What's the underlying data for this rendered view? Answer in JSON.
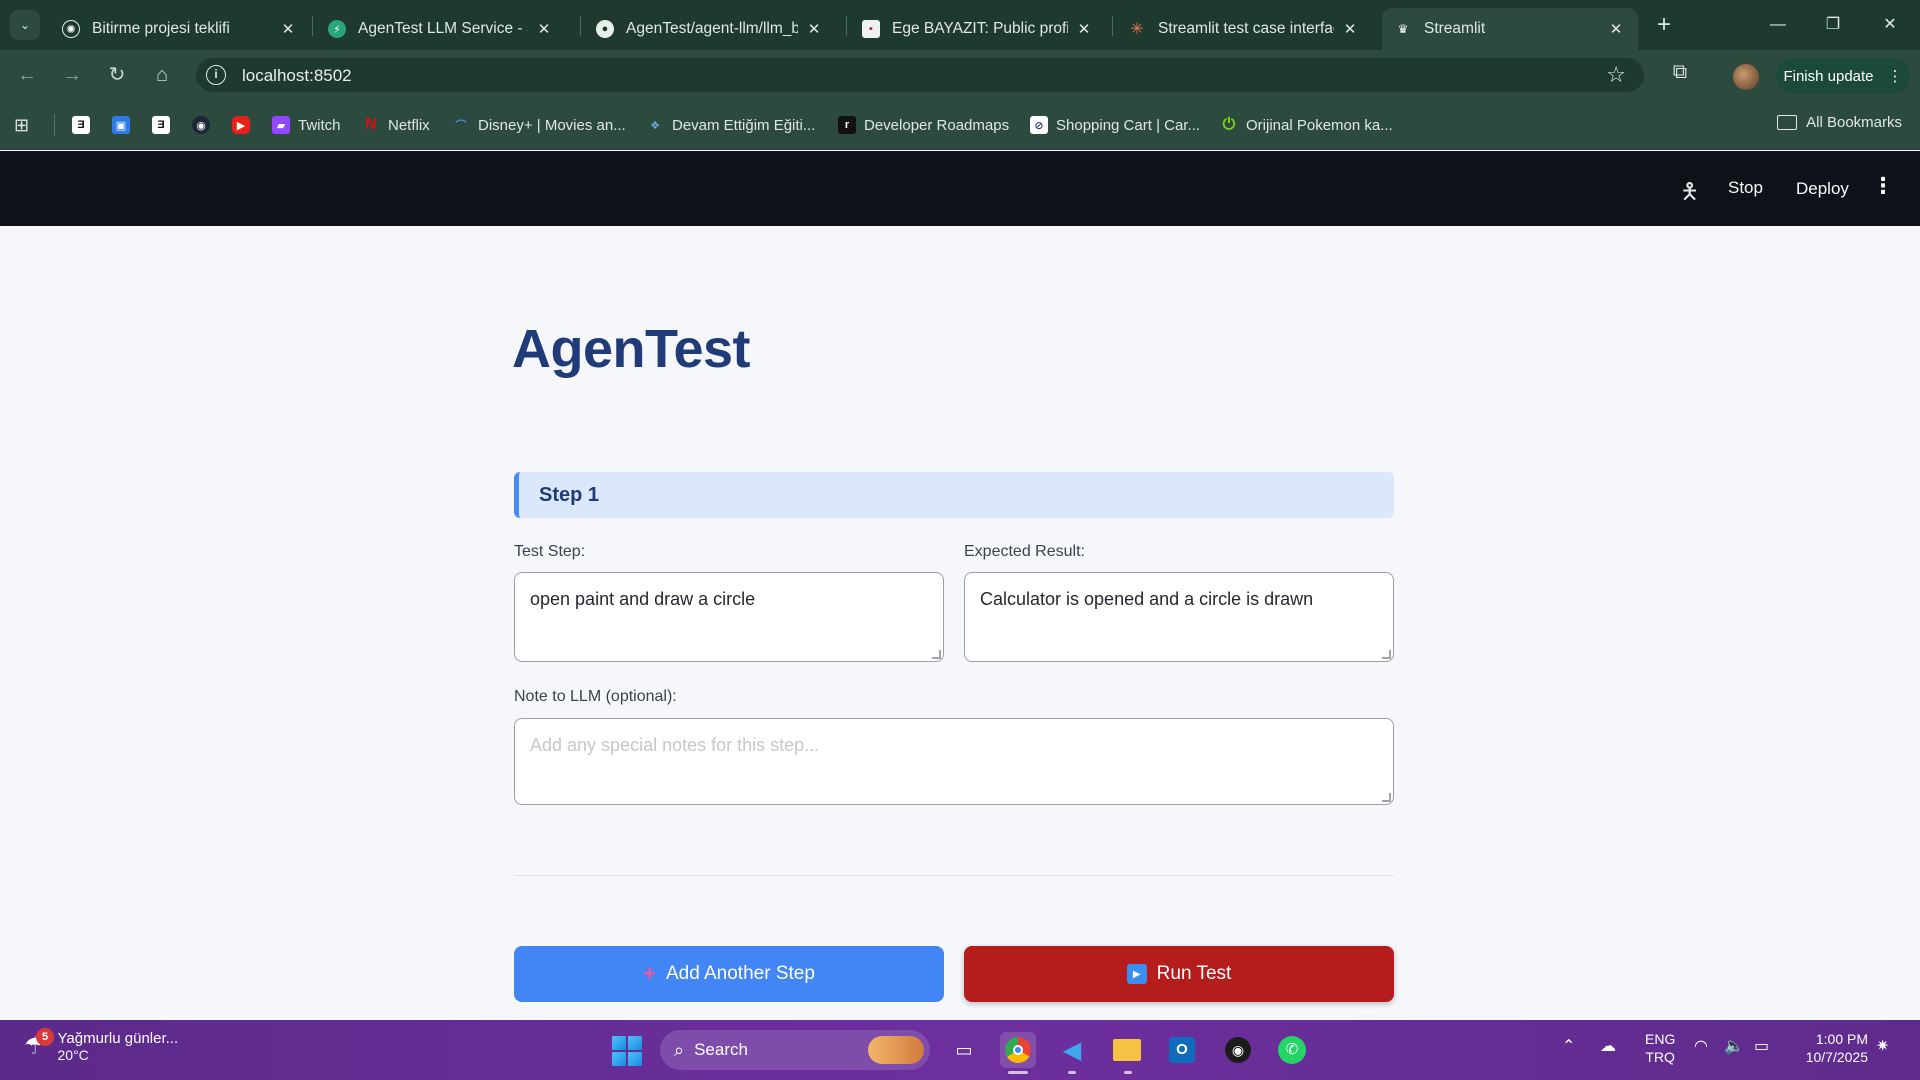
{
  "browser": {
    "tabs": [
      {
        "title": "Bitirme projesi teklifi",
        "favicon": "openai-icon",
        "active": false
      },
      {
        "title": "AgenTest LLM Service - Sw",
        "favicon": "swagger-icon",
        "active": false
      },
      {
        "title": "AgenTest/agent-llm/llm_ba",
        "favicon": "github-icon",
        "active": false
      },
      {
        "title": "Ege BAYAZIT: Public profile",
        "favicon": "profile-icon",
        "active": false
      },
      {
        "title": "Streamlit test case interfac",
        "favicon": "claude-icon",
        "active": false
      },
      {
        "title": "Streamlit",
        "favicon": "streamlit-icon",
        "active": true
      }
    ],
    "url": "localhost:8502",
    "finish_update": "Finish update",
    "bookmarks": [
      {
        "label": "",
        "icon": "epic-icon"
      },
      {
        "label": "",
        "icon": "store-icon"
      },
      {
        "label": "",
        "icon": "epic-icon"
      },
      {
        "label": "",
        "icon": "steam-icon"
      },
      {
        "label": "",
        "icon": "youtube-icon"
      },
      {
        "label": "Twitch",
        "icon": "twitch-icon"
      },
      {
        "label": "Netflix",
        "icon": "netflix-icon"
      },
      {
        "label": "Disney+ | Movies an...",
        "icon": "disney-icon"
      },
      {
        "label": "Devam Ettiğim Eğiti...",
        "icon": "bookmark-icon"
      },
      {
        "label": "Developer Roadmaps",
        "icon": "roadmap-icon"
      },
      {
        "label": "Shopping Cart | Car...",
        "icon": "cart-icon"
      },
      {
        "label": "Orijinal Pokemon ka...",
        "icon": "power-icon"
      }
    ],
    "all_bookmarks": "All Bookmarks"
  },
  "streamlit_header": {
    "stop": "Stop",
    "deploy": "Deploy"
  },
  "app": {
    "title": "AgenTest",
    "step_heading": "Step 1",
    "test_step_label": "Test Step:",
    "test_step_value": "open paint and draw a circle",
    "expected_label": "Expected Result:",
    "expected_value": "Calculator is opened and a circle is drawn",
    "note_label": "Note to LLM (optional):",
    "note_placeholder": "Add any special notes for this step...",
    "add_step_button": "Add Another Step",
    "run_test_button": "Run Test"
  },
  "taskbar": {
    "weather_badge": "5",
    "weather_text": "Yağmurlu günler...",
    "temperature": "20°C",
    "search": "Search",
    "lang_line1": "ENG",
    "lang_line2": "TRQ",
    "time": "1:00 PM",
    "date": "10/7/2025"
  },
  "colors": {
    "title": "#1f3b78",
    "add_button": "#4285f4",
    "run_button": "#b51c1c",
    "step_banner": "#dbe8fb"
  }
}
